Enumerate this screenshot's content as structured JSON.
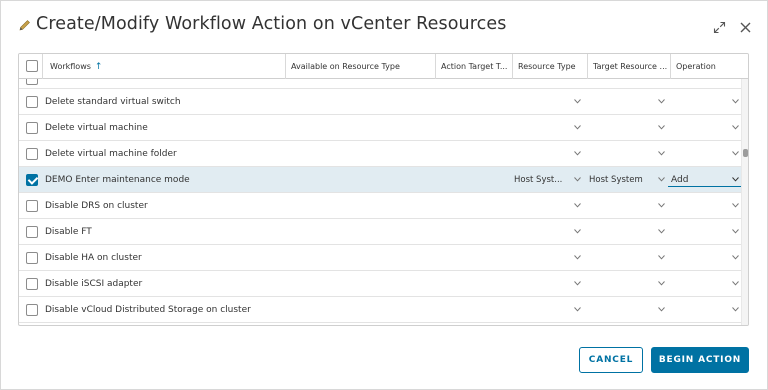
{
  "dialog": {
    "title": "Create/Modify Workflow Action on vCenter Resources",
    "icons": [
      "pencil-icon",
      "expand-icon",
      "close-icon"
    ]
  },
  "grid": {
    "columns": [
      {
        "label": "Workflows",
        "sorted": "ascending"
      },
      {
        "label": "Available on Resource Type"
      },
      {
        "label": "Action Target T..."
      },
      {
        "label": "Resource Type"
      },
      {
        "label": "Target Resource ..."
      },
      {
        "label": "Operation"
      }
    ],
    "rows": [
      {
        "name": "Delete standard virtual switch",
        "checked": false,
        "resource_type": "",
        "target_resource": "",
        "operation": ""
      },
      {
        "name": "Delete virtual machine",
        "checked": false,
        "resource_type": "",
        "target_resource": "",
        "operation": ""
      },
      {
        "name": "Delete virtual machine folder",
        "checked": false,
        "resource_type": "",
        "target_resource": "",
        "operation": ""
      },
      {
        "name": "DEMO Enter maintenance mode",
        "checked": true,
        "resource_type": "Host Syst...",
        "target_resource": "Host System",
        "operation": "Add"
      },
      {
        "name": "Disable DRS on cluster",
        "checked": false,
        "resource_type": "",
        "target_resource": "",
        "operation": ""
      },
      {
        "name": "Disable FT",
        "checked": false,
        "resource_type": "",
        "target_resource": "",
        "operation": ""
      },
      {
        "name": "Disable HA on cluster",
        "checked": false,
        "resource_type": "",
        "target_resource": "",
        "operation": ""
      },
      {
        "name": "Disable iSCSI adapter",
        "checked": false,
        "resource_type": "",
        "target_resource": "",
        "operation": ""
      },
      {
        "name": "Disable vCloud Distributed Storage on cluster",
        "checked": false,
        "resource_type": "",
        "target_resource": "",
        "operation": ""
      }
    ]
  },
  "footer": {
    "cancel_label": "CANCEL",
    "primary_label": "BEGIN ACTION"
  },
  "colors": {
    "accent": "#0072a3",
    "selected_row": "#e1ecf2"
  }
}
